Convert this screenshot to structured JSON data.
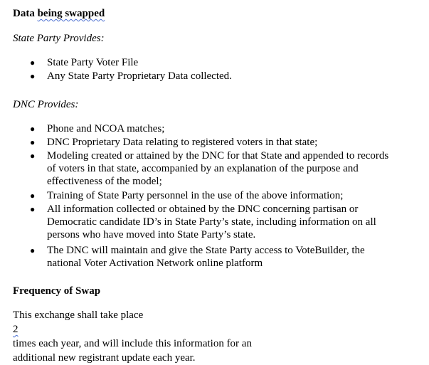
{
  "heading1": {
    "pre": "Data ",
    "squiggle": "being swapped"
  },
  "state_party_label": "State Party Provides:",
  "state_party_items": [
    [
      "State Party Voter File"
    ],
    [
      "Any State Party Proprietary Data collected."
    ]
  ],
  "dnc_label": "DNC Provides:",
  "dnc_items": [
    [
      "Phone and NCOA matches;"
    ],
    [
      "DNC Proprietary Data relating to registered voters in that state;"
    ],
    [
      "Modeling created or attained by the DNC for that State and appended to records",
      "of voters in that state, accompanied by an explanation of the purpose and",
      "effectiveness of the model;"
    ],
    [
      "Training of State Party personnel in the use of the above information;"
    ],
    [
      "All information collected or obtained by the DNC concerning partisan or",
      "Democratic candidate ID’s in State Party’s state, including information on all",
      "persons who have moved into State Party’s state."
    ],
    [
      "The DNC will maintain and give the State Party access to VoteBuilder, the",
      "national Voter Activation Network online platform"
    ]
  ],
  "heading2": "Frequency of Swap",
  "frequency_para": {
    "pre": "This exchange shall take place ",
    "num": "2",
    "post": " times each year, and will include this information for an",
    "line2": "additional new registrant update each year."
  },
  "bullet_symbol": "●"
}
